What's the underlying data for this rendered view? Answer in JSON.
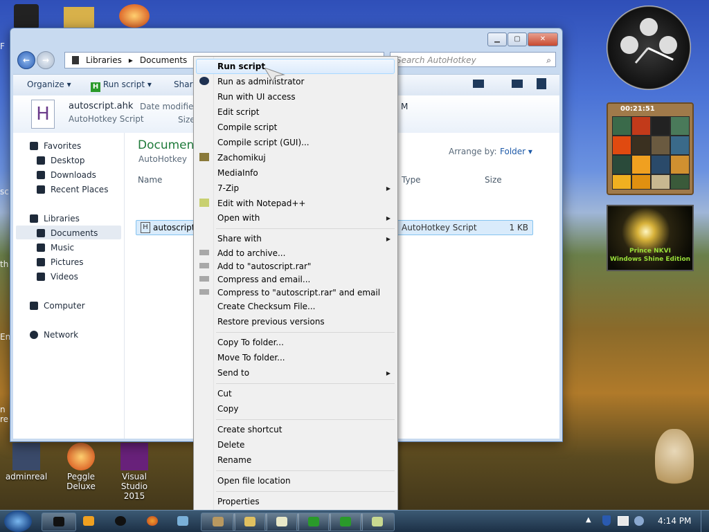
{
  "desktop": {
    "icons": [
      {
        "label": "adminreal"
      },
      {
        "label": "Peggle Deluxe"
      },
      {
        "label": "Visual Studio 2015"
      }
    ],
    "edge_fragments": [
      "F",
      "sc",
      "th",
      "En",
      "n re"
    ]
  },
  "explorer": {
    "breadcrumb": [
      "Libraries",
      "Documents"
    ],
    "search_placeholder": "Search AutoHotkey",
    "toolbar": {
      "organize": "Organize",
      "run_script": "Run script",
      "share": "Share"
    },
    "details": {
      "filename": "autoscript.ahk",
      "filetype": "AutoHotkey Script",
      "date_label": "Date modified:",
      "size_label": "Size:",
      "time_fragment": "M"
    },
    "nav": {
      "favorites": "Favorites",
      "desktop": "Desktop",
      "downloads": "Downloads",
      "recent": "Recent Places",
      "libraries": "Libraries",
      "documents": "Documents",
      "music": "Music",
      "pictures": "Pictures",
      "videos": "Videos",
      "computer": "Computer",
      "network": "Network"
    },
    "pane": {
      "title": "Documen",
      "subtitle": "AutoHotkey",
      "arrange_label": "Arrange by:",
      "arrange_value": "Folder",
      "columns": {
        "name": "Name",
        "type": "Type",
        "size": "Size"
      },
      "file": {
        "name": "autoscript.a",
        "type": "AutoHotkey Script",
        "size": "1 KB"
      }
    }
  },
  "context_menu": {
    "items": [
      "Run script",
      "Run as administrator",
      "Run with UI access",
      "Edit script",
      "Compile script",
      "Compile script (GUI)...",
      "Zachomikuj",
      "MediaInfo",
      "7-Zip",
      "Edit with Notepad++",
      "Open with",
      "Share with",
      "Add to archive...",
      "Add to \"autoscript.rar\"",
      "Compress and email...",
      "Compress to \"autoscript.rar\" and email",
      "Create Checksum File...",
      "Restore previous versions",
      "Copy To folder...",
      "Move To folder...",
      "Send to",
      "Cut",
      "Copy",
      "Create shortcut",
      "Delete",
      "Rename",
      "Open file location",
      "Properties"
    ]
  },
  "gadgets": {
    "timer": "00:21:51",
    "photo_caption_1": "Prince NKVI",
    "photo_caption_2": "Windows Shine Edition"
  },
  "taskbar": {
    "time": "4:14 PM"
  },
  "colors": {
    "accent": "#1e395b",
    "taskbar": "#1c3046",
    "highlight": "#dcebfc"
  }
}
